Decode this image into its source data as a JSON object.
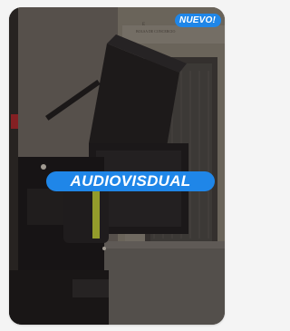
{
  "card": {
    "badge": "NUEVO!",
    "category": "AUDIOVISDUAL",
    "sign_text": "E  BOLSA DE CONCERCIO",
    "colors": {
      "accent": "#1f86e8",
      "page_background": "#f4f4f4",
      "badge_text": "#ffffff"
    }
  }
}
